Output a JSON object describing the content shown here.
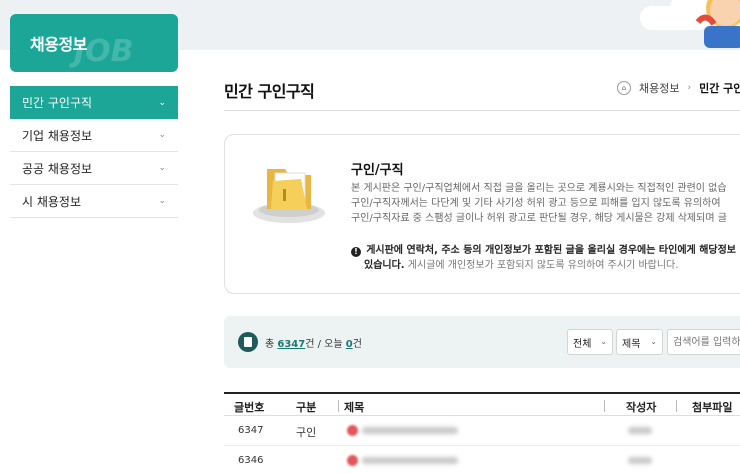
{
  "sidebar": {
    "header_title": "채용정보",
    "header_deco": "JOB",
    "items": [
      {
        "label": "민간 구인구직",
        "active": true
      },
      {
        "label": "기업 채용정보",
        "active": false
      },
      {
        "label": "공공 채용정보",
        "active": false
      },
      {
        "label": "시 채용정보",
        "active": false
      }
    ],
    "chevron": "⌄"
  },
  "header": {
    "page_title": "민간 구인구직",
    "breadcrumb": [
      "채용정보",
      "민간 구인구직"
    ]
  },
  "info": {
    "title": "구인/구직",
    "body_lines": [
      "본 게시판은 구인/구직업체에서 직접 글을 올리는 곳으로 계룡시와는 직접적인 관련이 없습",
      "구인/구직자께서는 다단계 및 기타 사기성 허위 광고 등으로 피해를 입지 않도록 유의하여",
      "구인/구직자료 중 스팸성 글이나 허위 광고로 판단될 경우, 해당 게시물은 강제 삭제되며 글"
    ],
    "warning_bold_1": "게시판에 연락처, 주소 등의 개인정보가 포함된 글을 올리실 경우에는 타인에게 해당정보",
    "warning_bold_2": "있습니다.",
    "warning_rest": " 게시글에 개인정보가 포함되지 않도록 유의하여 주시기 바랍니다."
  },
  "search": {
    "count_prefix": "총 ",
    "total": "6347",
    "count_mid": "건 / 오늘 ",
    "today": "0",
    "count_suffix": "건",
    "select_scope": "전체",
    "select_field": "제목",
    "placeholder": "검색어를 입력하세요"
  },
  "table": {
    "headers": [
      "글번호",
      "구분",
      "제목",
      "작성자",
      "첨부파일"
    ],
    "rows": [
      {
        "no": "6347",
        "kind": "구인"
      },
      {
        "no": "6346",
        "kind": ""
      }
    ]
  },
  "colors": {
    "accent": "#1ba698",
    "dark_teal": "#1f5b5a",
    "search_bg": "#edf2f2"
  }
}
